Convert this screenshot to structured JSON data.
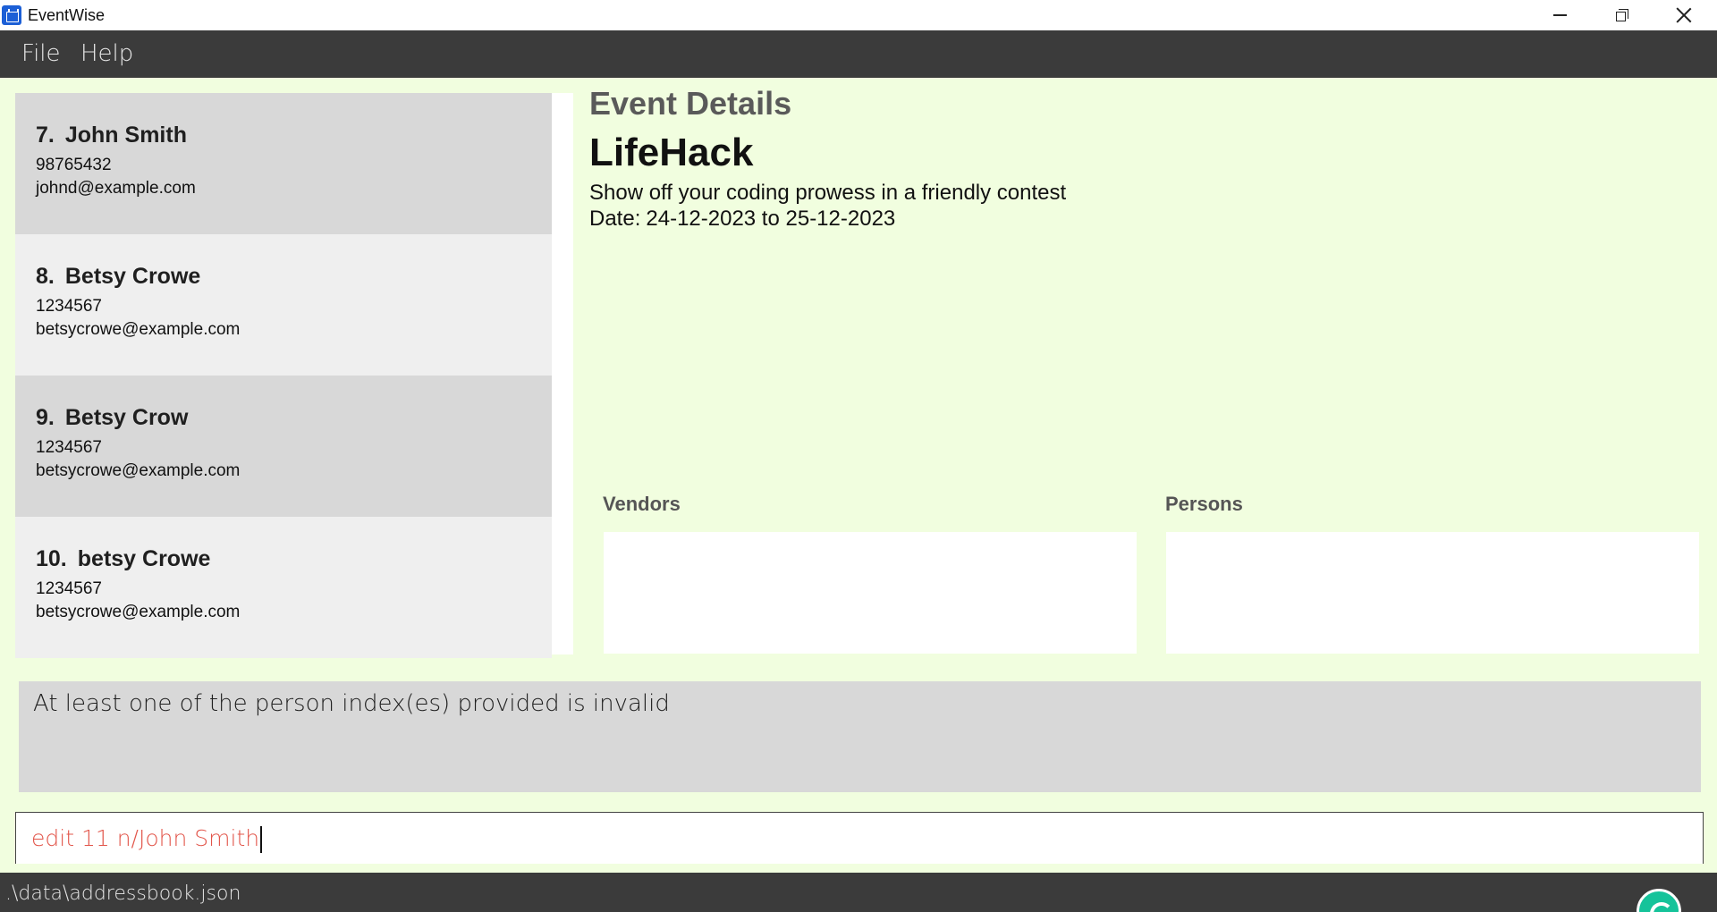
{
  "window": {
    "title": "EventWise",
    "icon": "calendar-icon",
    "controls": [
      "minimize-icon",
      "restore-icon",
      "close-icon"
    ]
  },
  "menu": {
    "file": "File",
    "help": "Help"
  },
  "persons": [
    {
      "index": "7.",
      "name": "John Smith",
      "phone": "98765432",
      "email": "johnd@example.com",
      "selected": true
    },
    {
      "index": "8.",
      "name": "Betsy Crowe",
      "phone": "1234567",
      "email": "betsycrowe@example.com",
      "selected": false
    },
    {
      "index": "9.",
      "name": "Betsy Crow",
      "phone": "1234567",
      "email": "betsycrowe@example.com",
      "selected": true
    },
    {
      "index": "10.",
      "name": "betsy Crowe",
      "phone": "1234567",
      "email": "betsycrowe@example.com",
      "selected": false
    }
  ],
  "event": {
    "heading": "Event Details",
    "name": "LifeHack",
    "description": "Show off your coding prowess in a friendly contest",
    "date_label": "Date:",
    "date_range": "24-12-2023 to 25-12-2023",
    "vendors_label": "Vendors",
    "persons_label": "Persons"
  },
  "result": {
    "message": "At least one of the person index(es) provided is invalid"
  },
  "command": {
    "value": "edit 11 n/John Smith"
  },
  "status": {
    "path": ".\\data\\addressbook.json"
  },
  "colors": {
    "background": "#f1fedf",
    "menubar": "#3b3b3b",
    "card_dark": "#d8d8d8",
    "card_light": "#efefef",
    "command_text": "#e2554a",
    "title_icon": "#1c5fd6"
  }
}
